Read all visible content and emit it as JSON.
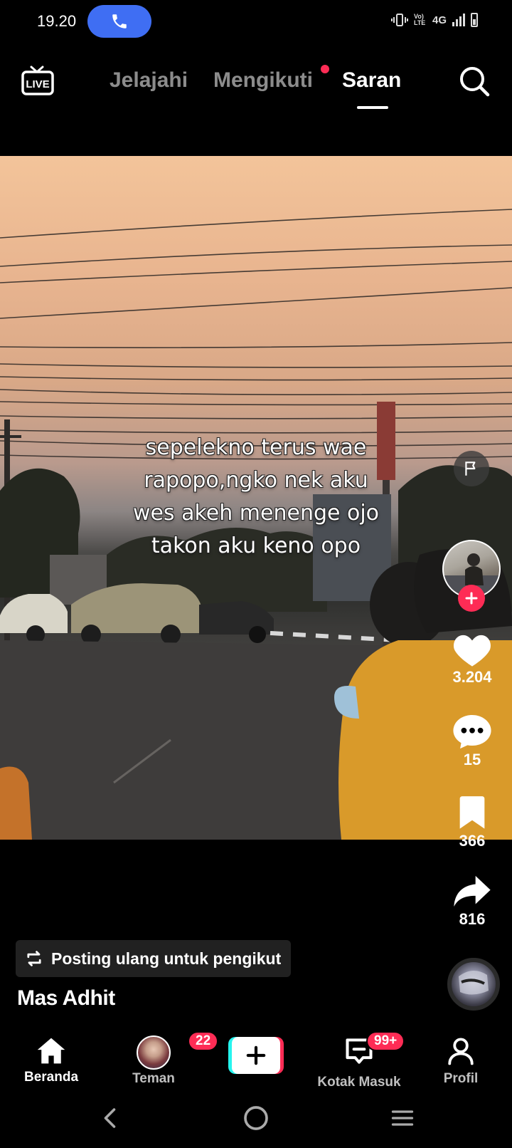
{
  "status_bar": {
    "time": "19.20",
    "network_lte": "Vo) LTE",
    "network_type": "4G",
    "icons": [
      "call-icon",
      "vibrate-icon",
      "signal-icon",
      "battery-icon"
    ]
  },
  "top_nav": {
    "live_label": "LIVE",
    "tabs": [
      {
        "label": "Jelajahi",
        "active": false
      },
      {
        "label": "Mengikuti",
        "active": false,
        "has_dot": true
      },
      {
        "label": "Saran",
        "active": true
      }
    ],
    "icons": [
      "live-icon",
      "search-icon"
    ]
  },
  "video": {
    "caption_lines": [
      "sepelekno terus wae",
      "rapopo,ngko nek aku",
      "wes akeh menenge ojo",
      "takon aku keno opo"
    ]
  },
  "actions": {
    "likes": "3.204",
    "comments": "15",
    "bookmarks": "366",
    "shares": "816",
    "icons": [
      "flag-icon",
      "plus-icon",
      "heart-icon",
      "comment-icon",
      "bookmark-icon",
      "share-icon"
    ]
  },
  "post": {
    "repost_label": "Posting ulang untuk pengikut",
    "username": "Mas Adhit"
  },
  "bottom_tabs": {
    "items": [
      {
        "label": "Beranda",
        "active": true
      },
      {
        "label": "Teman",
        "badge": "22"
      },
      {
        "label": ""
      },
      {
        "label": "Kotak Masuk",
        "badge": "99+"
      },
      {
        "label": "Profil"
      }
    ]
  },
  "colors": {
    "accent": "#fe2c55",
    "cyan": "#25f4ee",
    "call_pill": "#3f6ef3"
  }
}
